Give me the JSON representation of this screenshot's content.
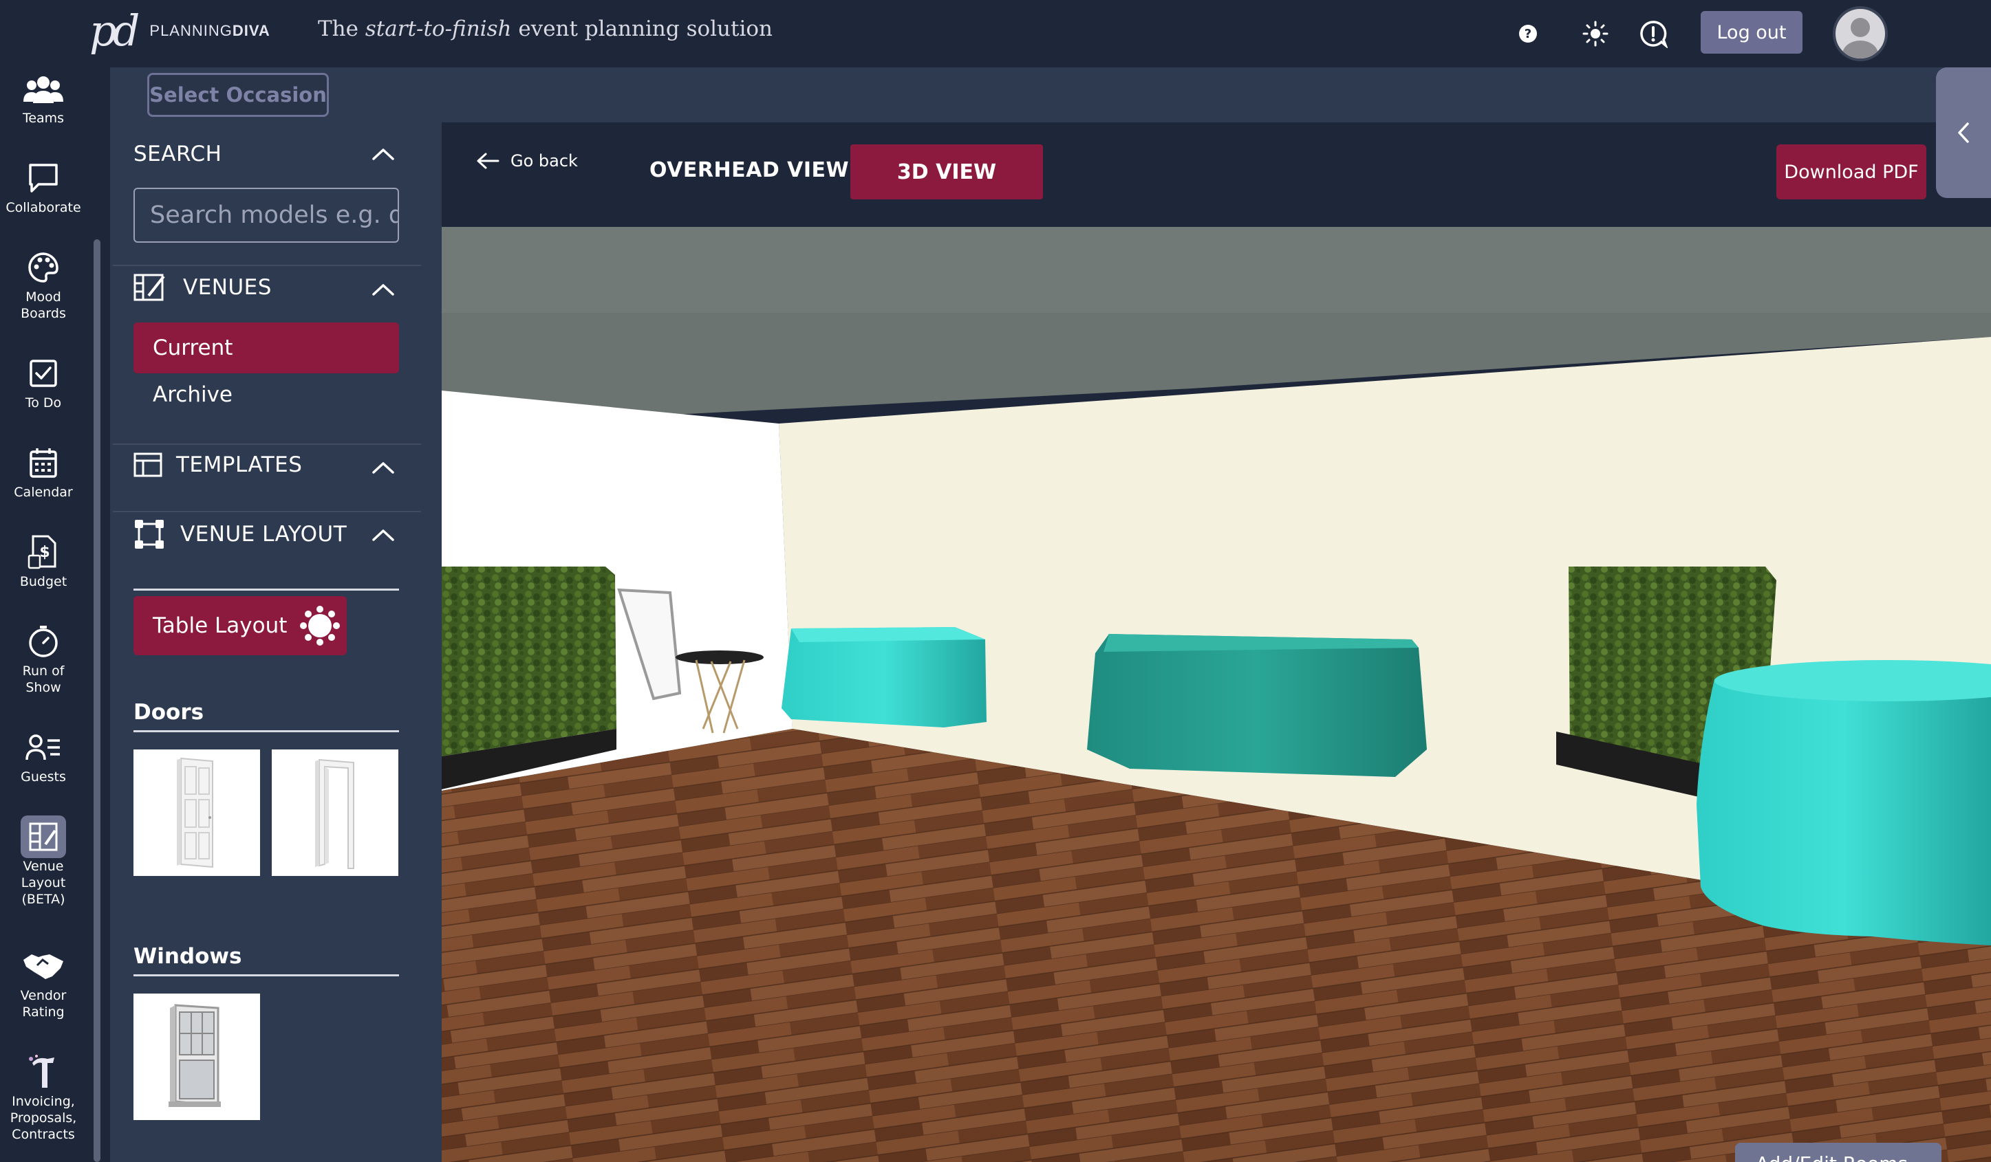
{
  "header": {
    "logo_mark": "pd",
    "logo_text_light": "PLANNING",
    "logo_text_bold": "DIVA",
    "tagline_prefix": "The ",
    "tagline_italic": "start-to-finish",
    "tagline_suffix": " event planning solution",
    "logout_label": "Log out"
  },
  "nav": {
    "items": [
      {
        "label": "Teams",
        "icon": "teams-icon"
      },
      {
        "label": "Collaborate",
        "icon": "chat-icon"
      },
      {
        "label": "Mood\nBoards",
        "icon": "palette-icon"
      },
      {
        "label": "To Do",
        "icon": "checkbox-icon"
      },
      {
        "label": "Calendar",
        "icon": "calendar-icon"
      },
      {
        "label": "Budget",
        "icon": "budget-icon"
      },
      {
        "label": "Run of\nShow",
        "icon": "stopwatch-icon"
      },
      {
        "label": "Guests",
        "icon": "guests-icon"
      },
      {
        "label": "Venue\nLayout\n(BETA)",
        "icon": "venue-layout-icon"
      },
      {
        "label": "Vendor\nRating",
        "icon": "handshake-icon"
      },
      {
        "label": "Invoicing,\nProposals,\nContracts",
        "icon": "invoice-icon"
      }
    ]
  },
  "occasion": {
    "select_label": "Select Occasion"
  },
  "panel": {
    "search": {
      "title": "SEARCH",
      "placeholder": "Search models e.g. desk"
    },
    "venues": {
      "title": "VENUES",
      "current": "Current",
      "archive": "Archive"
    },
    "templates": {
      "title": "TEMPLATES"
    },
    "venue_layout": {
      "title": "VENUE LAYOUT",
      "table_layout_label": "Table Layout"
    },
    "doors": {
      "title": "Doors"
    },
    "windows": {
      "title": "Windows"
    }
  },
  "main": {
    "go_back": "Go back",
    "overhead_tab": "OVERHEAD VIEW",
    "view3d_tab": "3D VIEW",
    "download_label": "Download PDF",
    "add_edit_label": "Add/Edit Rooms"
  },
  "colors": {
    "navy": "#1e2639",
    "panel": "#2e3a50",
    "accent": "#8c1a3e",
    "muted_button": "#6c6d92"
  }
}
